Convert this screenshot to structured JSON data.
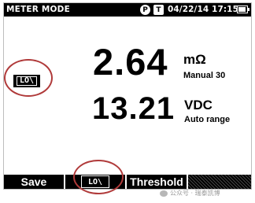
{
  "status_bar": {
    "mode_title": "METER MODE",
    "badge_p": "P",
    "badge_t": "T",
    "datetime": "04/22/14 17:15"
  },
  "indicator": {
    "lo_label": "LO\\"
  },
  "primary": {
    "value": "2.64",
    "unit": "mΩ",
    "range_mode": "Manual 30"
  },
  "secondary": {
    "value": "13.21",
    "unit": "VDC",
    "range_mode": "Auto range"
  },
  "softkeys": {
    "key1": "Save",
    "key2": "LO\\",
    "key3": "Threshold",
    "key4": ""
  },
  "watermark": {
    "text": "公众号 · 瑞泰凯博"
  },
  "colors": {
    "annotation_ring": "#b03a3a",
    "bar_background": "#000000"
  }
}
